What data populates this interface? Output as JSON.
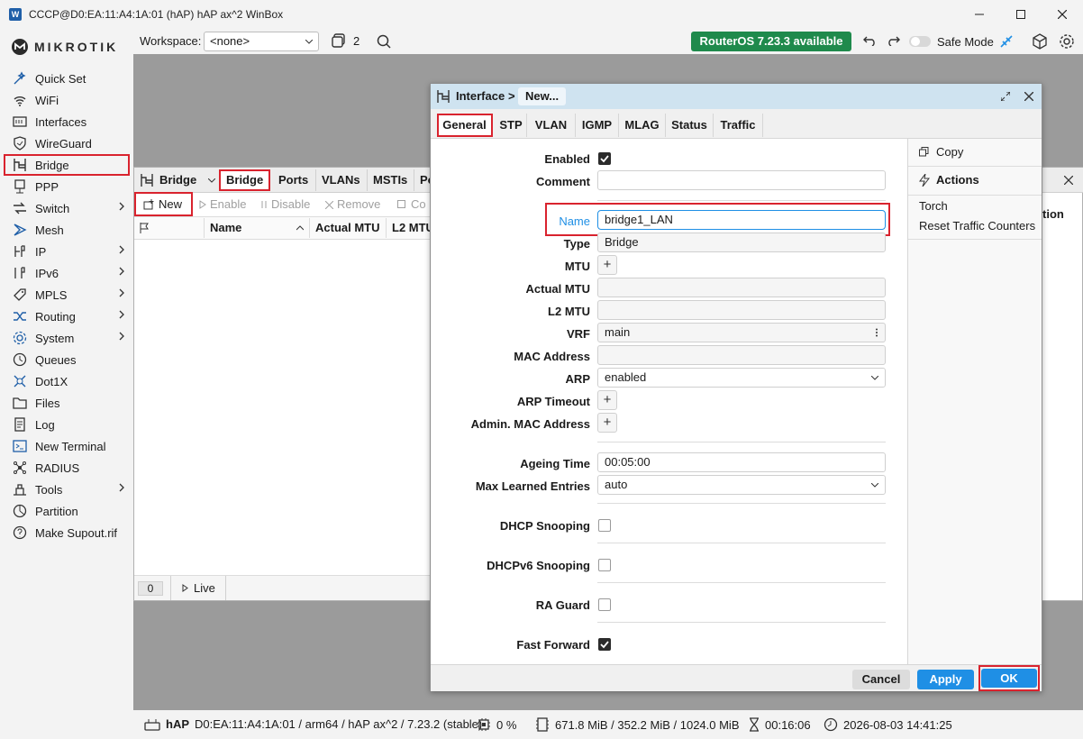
{
  "window": {
    "title": "CCCP@D0:EA:11:A4:1A:01 (hAP) hAP ax^2 WinBox",
    "app_icon_text": "W"
  },
  "logo": {
    "text": "MIKROTIK"
  },
  "sidebar": {
    "items": [
      {
        "label": "Quick Set",
        "icon": "wand-icon"
      },
      {
        "label": "WiFi",
        "icon": "wifi-icon"
      },
      {
        "label": "Interfaces",
        "icon": "interfaces-icon"
      },
      {
        "label": "WireGuard",
        "icon": "wireguard-icon"
      },
      {
        "label": "Bridge",
        "icon": "bridge-icon"
      },
      {
        "label": "PPP",
        "icon": "ppp-icon"
      },
      {
        "label": "Switch",
        "icon": "switch-icon"
      },
      {
        "label": "Mesh",
        "icon": "mesh-icon"
      },
      {
        "label": "IP",
        "icon": "ip-icon"
      },
      {
        "label": "IPv6",
        "icon": "ipv6-icon"
      },
      {
        "label": "MPLS",
        "icon": "mpls-icon"
      },
      {
        "label": "Routing",
        "icon": "routing-icon"
      },
      {
        "label": "System",
        "icon": "system-icon"
      },
      {
        "label": "Queues",
        "icon": "queues-icon"
      },
      {
        "label": "Dot1X",
        "icon": "dot1x-icon"
      },
      {
        "label": "Files",
        "icon": "files-icon"
      },
      {
        "label": "Log",
        "icon": "log-icon"
      },
      {
        "label": "New Terminal",
        "icon": "terminal-icon"
      },
      {
        "label": "RADIUS",
        "icon": "radius-icon"
      },
      {
        "label": "Tools",
        "icon": "tools-icon"
      },
      {
        "label": "Partition",
        "icon": "partition-icon"
      },
      {
        "label": "Make Supout.rif",
        "icon": "supout-icon"
      }
    ]
  },
  "topbar": {
    "workspace_label": "Workspace:",
    "workspace_value": "<none>",
    "windows_count": "2",
    "update_badge": "RouterOS 7.23.3 available",
    "safe_mode_label": "Safe Mode"
  },
  "bridge_window": {
    "title": "Bridge",
    "tabs": [
      "Bridge",
      "Ports",
      "VLANs",
      "MSTIs",
      "Po"
    ],
    "toolbar": {
      "new": "New",
      "enable": "Enable",
      "disable": "Disable",
      "remove": "Remove",
      "copy": "Co"
    },
    "columns": [
      "Name",
      "Actual MTU",
      "L2 MTU"
    ],
    "footer": {
      "count": "0",
      "live": "Live"
    }
  },
  "back_window": {
    "partial_text": "tion"
  },
  "dialog": {
    "breadcrumb_root": "Interface",
    "breadcrumb_sep": ">",
    "breadcrumb_current": "New...",
    "tabs": [
      "General",
      "STP",
      "VLAN",
      "IGMP",
      "MLAG",
      "Status",
      "Traffic"
    ],
    "fields": {
      "enabled": {
        "label": "Enabled",
        "checked": true
      },
      "comment": {
        "label": "Comment",
        "value": ""
      },
      "name": {
        "label": "Name",
        "value": "bridge1_LAN"
      },
      "type": {
        "label": "Type",
        "value": "Bridge"
      },
      "mtu": {
        "label": "MTU"
      },
      "actual_mtu": {
        "label": "Actual MTU",
        "value": ""
      },
      "l2_mtu": {
        "label": "L2 MTU",
        "value": ""
      },
      "vrf": {
        "label": "VRF",
        "value": "main"
      },
      "mac_address": {
        "label": "MAC Address",
        "value": ""
      },
      "arp": {
        "label": "ARP",
        "value": "enabled"
      },
      "arp_timeout": {
        "label": "ARP Timeout"
      },
      "admin_mac": {
        "label": "Admin. MAC Address"
      },
      "ageing_time": {
        "label": "Ageing Time",
        "value": "00:05:00"
      },
      "max_learned": {
        "label": "Max Learned Entries",
        "value": "auto"
      },
      "dhcp_snooping": {
        "label": "DHCP Snooping",
        "checked": false
      },
      "dhcpv6_snooping": {
        "label": "DHCPv6 Snooping",
        "checked": false
      },
      "ra_guard": {
        "label": "RA Guard",
        "checked": false
      },
      "fast_forward": {
        "label": "Fast Forward",
        "checked": true
      }
    },
    "side": {
      "copy": "Copy",
      "actions_title": "Actions",
      "torch": "Torch",
      "reset": "Reset Traffic Counters"
    },
    "buttons": {
      "cancel": "Cancel",
      "apply": "Apply",
      "ok": "OK"
    }
  },
  "statusbar": {
    "device": "hAP",
    "info": "D0:EA:11:A4:1A:01 / arm64 / hAP ax^2 / 7.23.2 (stable)",
    "cpu": "0 %",
    "memory": "671.8 MiB / 352.2 MiB / 1024.0 MiB",
    "uptime": "00:16:06",
    "datetime": "2026-08-03 14:41:25"
  },
  "colors": {
    "accent": "#1f8fe5",
    "highlight": "#d9232e",
    "update_green": "#1f8a4c",
    "dialog_header": "#cfe3f0"
  }
}
